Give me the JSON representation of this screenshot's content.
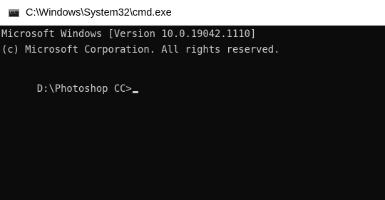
{
  "window": {
    "title": "C:\\Windows\\System32\\cmd.exe",
    "icon": "cmd-console-icon",
    "icon_text": "C:\\."
  },
  "console": {
    "line1": "Microsoft Windows [Version 10.0.19042.1110]",
    "line2": "(c) Microsoft Corporation. All rights reserved.",
    "line3": "",
    "prompt": "D:\\Photoshop CC>"
  },
  "colors": {
    "background": "#0c0c0c",
    "text": "#cccccc",
    "titlebar": "#ffffff"
  }
}
